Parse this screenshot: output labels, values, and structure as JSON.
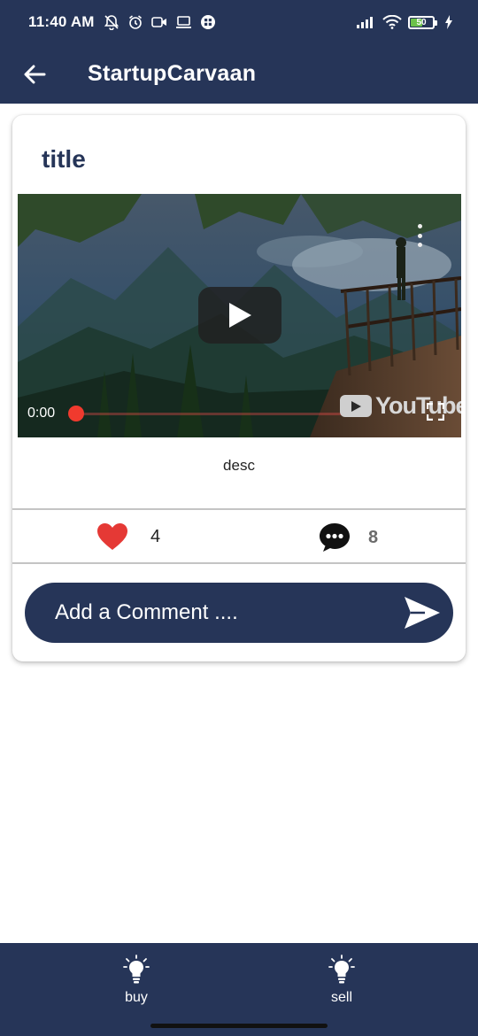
{
  "status_bar": {
    "time": "11:40 AM",
    "battery": "50",
    "icons": [
      "mute-bell-icon",
      "alarm-icon",
      "video-call-icon",
      "laptop-icon",
      "app-grid-icon",
      "signal-icon",
      "wifi-icon",
      "battery-icon",
      "charging-icon"
    ]
  },
  "app_bar": {
    "title": "StartupCarvaan",
    "back_icon": "arrow-left-icon"
  },
  "post": {
    "title": "title",
    "video": {
      "time": "0:00",
      "brand": "YouTube",
      "played_fraction": 0
    },
    "description": "desc",
    "likes": "4",
    "comments": "8",
    "comment_placeholder": "Add a Comment ...."
  },
  "bottom_nav": {
    "items": [
      {
        "label": "buy",
        "icon": "lightbulb-icon"
      },
      {
        "label": "sell",
        "icon": "lightbulb-icon"
      }
    ]
  },
  "colors": {
    "primary": "#263558",
    "like": "#e53935",
    "progress": "#f03a2e"
  }
}
